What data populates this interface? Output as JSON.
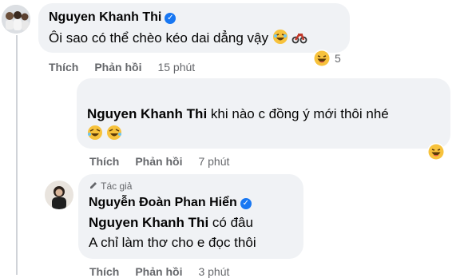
{
  "comment1": {
    "author": "Nguyen Khanh Thi",
    "text": "Ôi sao có thể chèo kéo dai dẳng vậy",
    "like_label": "Thích",
    "reply_label": "Phản hồi",
    "time": "15 phút",
    "reaction_count": "5"
  },
  "reply1": {
    "mention": "Nguyen Khanh Thi",
    "text": "khi nào c đồng ý mới thôi nhé",
    "like_label": "Thích",
    "reply_label": "Phản hồi",
    "time": "7 phút"
  },
  "reply2": {
    "badge": "Tác giả",
    "author": "Nguyễn Đoàn Phan Hiển",
    "mention": "Nguyen Khanh Thi",
    "text_line1_rest": "có đâu",
    "text_line2": "A chỉ làm thơ cho e đọc thôi",
    "like_label": "Thích",
    "reply_label": "Phản hồi",
    "time": "3 phút"
  },
  "colors": {
    "bubble": "#f0f2f5",
    "meta": "#65676b",
    "verified": "#1877f2",
    "emoji": "#f7c23c"
  }
}
